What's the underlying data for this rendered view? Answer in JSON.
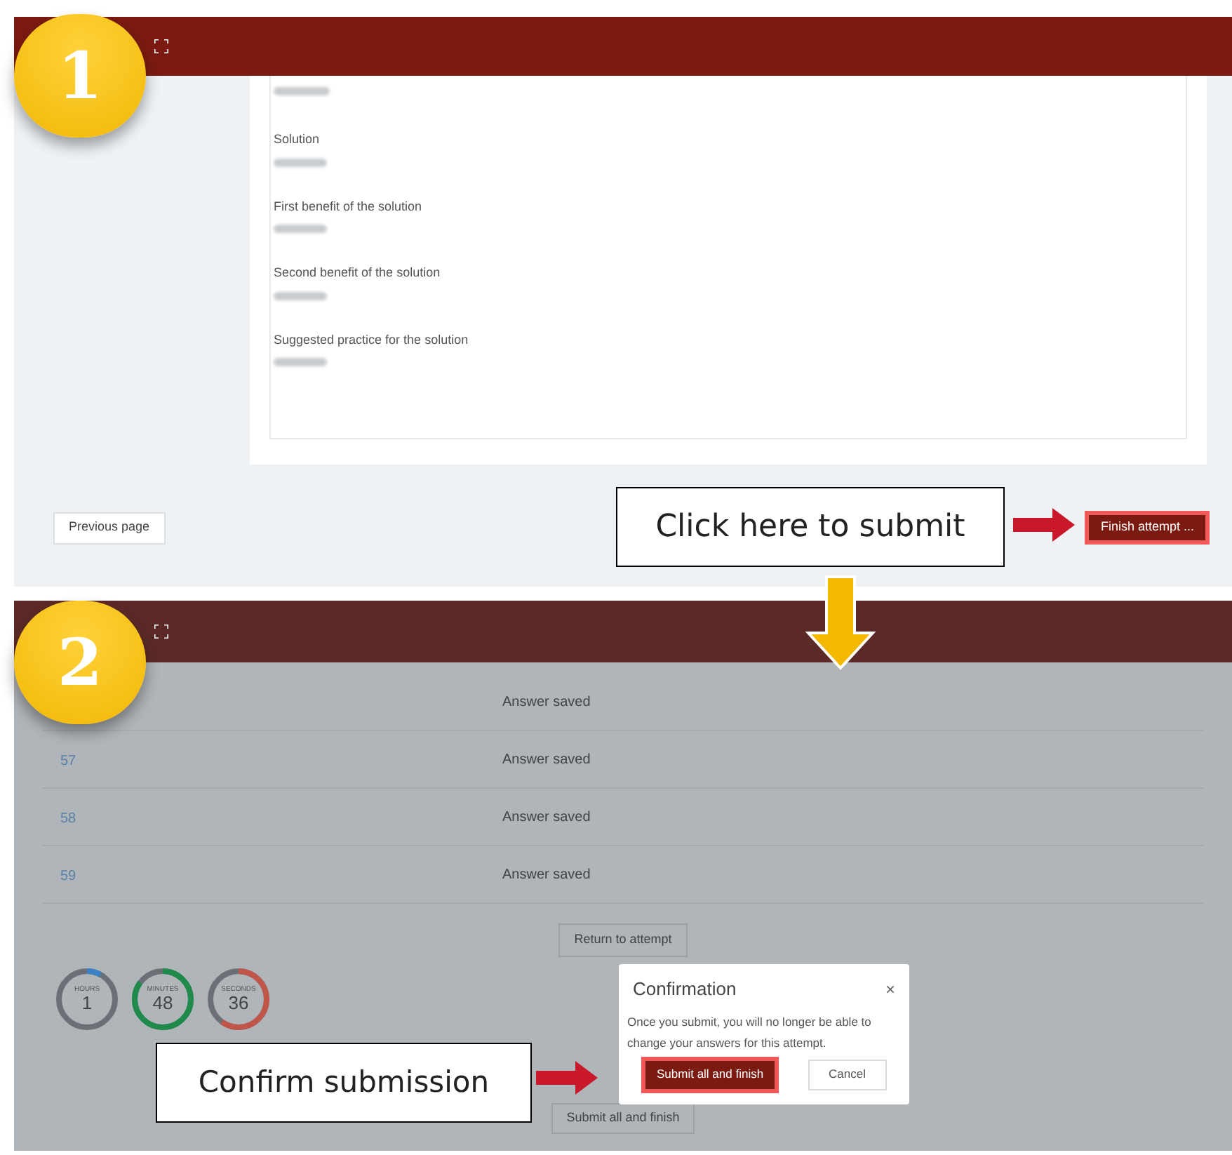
{
  "step_badges": [
    "1",
    "2"
  ],
  "screen_1": {
    "fields": [
      {
        "label": "Solution"
      },
      {
        "label": "First benefit of the solution"
      },
      {
        "label": "Second benefit of the solution"
      },
      {
        "label": "Suggested practice for the solution"
      }
    ],
    "previous_button": "Previous page",
    "finish_button": "Finish attempt ..."
  },
  "callout_1": "Click here to submit",
  "screen_2": {
    "rows": [
      {
        "status": "Answer saved"
      },
      {
        "number": "57",
        "status": "Answer saved"
      },
      {
        "number": "58",
        "status": "Answer saved"
      },
      {
        "number": "59",
        "status": "Answer saved"
      }
    ],
    "return_button": "Return to attempt",
    "timers": [
      {
        "label": "HOURS",
        "value": "1",
        "level": 0.08,
        "color": "#3b82c4"
      },
      {
        "label": "MINUTES",
        "value": "48",
        "level": 0.85,
        "color": "#1f8a4c"
      },
      {
        "label": "SECONDS",
        "value": "36",
        "level": 0.6,
        "color": "#c0564a"
      }
    ],
    "submit_button": "Submit all and finish",
    "dialog": {
      "title": "Confirmation",
      "close": "×",
      "message": "Once you submit, you will no longer be able to change your answers for this attempt.",
      "submit": "Submit all and finish",
      "cancel": "Cancel"
    }
  },
  "callout_2": "Confirm submission"
}
